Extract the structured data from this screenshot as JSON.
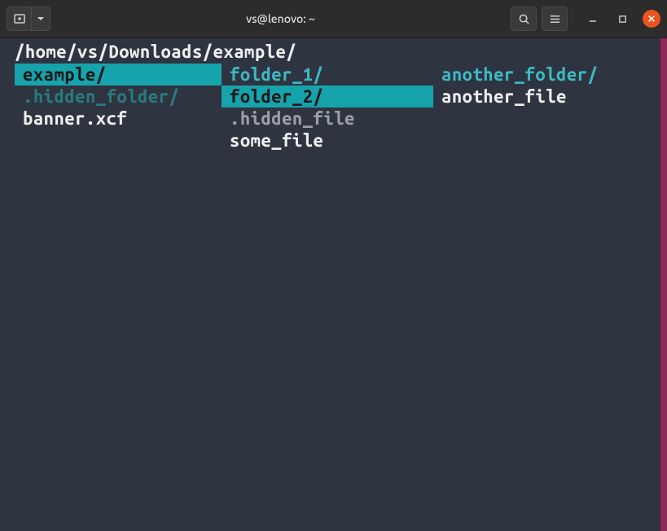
{
  "window": {
    "title": "vs@lenovo: ~"
  },
  "terminal": {
    "current_path": "/home/vs/Downloads/example/",
    "columns": [
      [
        {
          "name": "example/",
          "type": "folder",
          "selected": true
        },
        {
          "name": ".hidden_folder/",
          "type": "hidden-folder",
          "selected": false
        },
        {
          "name": "banner.xcf",
          "type": "file",
          "selected": false
        }
      ],
      [
        {
          "name": "folder_1/",
          "type": "folder",
          "selected": false
        },
        {
          "name": "folder_2/",
          "type": "folder",
          "selected": true
        },
        {
          "name": ".hidden_file",
          "type": "hidden-file",
          "selected": false
        },
        {
          "name": "some_file",
          "type": "file",
          "selected": false
        }
      ],
      [
        {
          "name": "another_folder/",
          "type": "folder",
          "selected": false
        },
        {
          "name": "another_file",
          "type": "file",
          "selected": false
        }
      ]
    ]
  }
}
